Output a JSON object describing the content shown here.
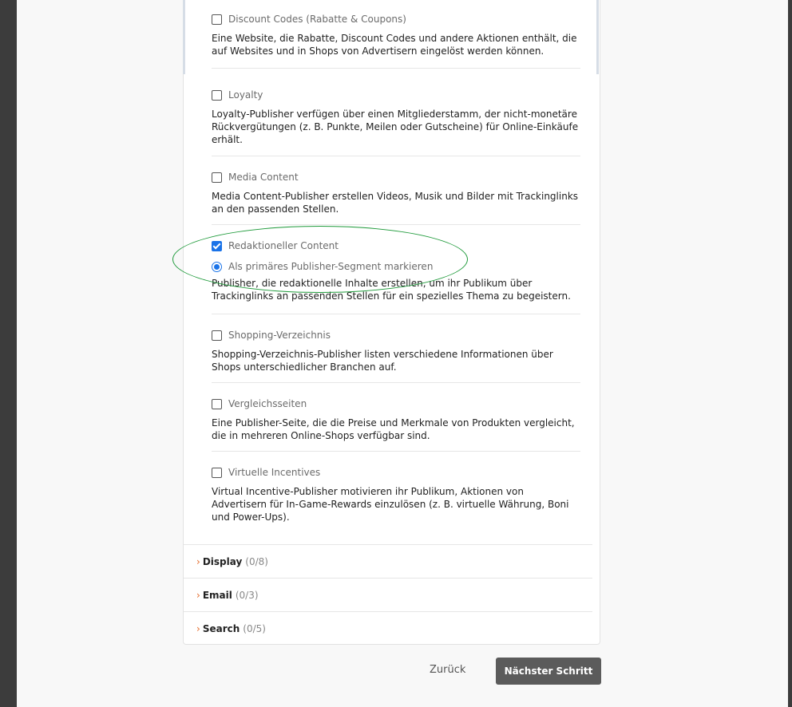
{
  "publisher_segments": [
    {
      "label": "Discount Codes (Rabatte & Coupons)",
      "checked": false,
      "description": "Eine Website, die Rabatte, Discount Codes und andere Aktionen enthält, die auf Websites und in Shops von Advertisern eingelöst werden können."
    },
    {
      "label": "Loyalty",
      "checked": false,
      "description": "Loyalty-Publisher verfügen über einen Mitgliederstamm, der nicht-monetäre Rückvergütungen (z. B. Punkte, Meilen oder Gutscheine) für Online-Einkäufe erhält."
    },
    {
      "label": "Media Content",
      "checked": false,
      "description": "Media Content-Publisher erstellen Videos, Musik und Bilder mit Trackinglinks an den passenden Stellen."
    },
    {
      "label": "Redaktioneller Content",
      "checked": true,
      "primary_label": "Als primäres Publisher-Segment markieren",
      "description": "Publisher, die redaktionelle Inhalte erstellen, um ihr Publikum über Trackinglinks an passenden Stellen für ein spezielles Thema zu begeistern."
    },
    {
      "label": "Shopping-Verzeichnis",
      "checked": false,
      "description": "Shopping-Verzeichnis-Publisher listen verschiedene Informationen über Shops unterschiedlicher Branchen auf."
    },
    {
      "label": "Vergleichsseiten",
      "checked": false,
      "description": "Eine Publisher-Seite, die die Preise und Merkmale von Produkten vergleicht, die in mehreren Online-Shops verfügbar sind."
    },
    {
      "label": "Virtuelle Incentives",
      "checked": false,
      "description": "Virtual Incentive-Publisher motivieren ihr Publikum, Aktionen von Advertisern für In-Game-Rewards einzulösen (z. B. virtuelle Währung, Boni und Power-Ups)."
    }
  ],
  "accordion": [
    {
      "name": "Display",
      "count": "(0/8)"
    },
    {
      "name": "Email",
      "count": "(0/3)"
    },
    {
      "name": "Search",
      "count": "(0/5)"
    }
  ],
  "buttons": {
    "back": "Zurück",
    "next": "Nächster Schritt"
  },
  "colors": {
    "accent": "#1a73e8",
    "chevron": "#e46a2a",
    "highlight": "#1e9a3a",
    "next_button": "#5b5b5b"
  }
}
